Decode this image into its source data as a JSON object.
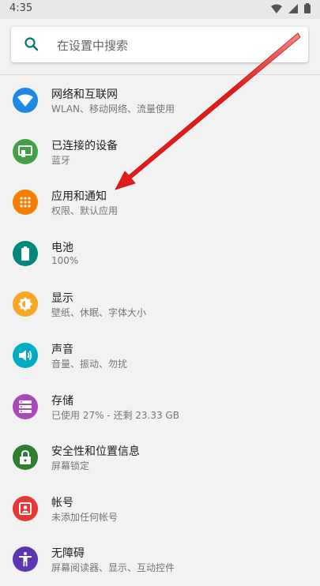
{
  "status_bar": {
    "time": "4:35"
  },
  "search": {
    "placeholder": "在设置中搜索"
  },
  "settings": [
    {
      "title": "网络和互联网",
      "subtitle": "WLAN、移动网络、流量使用",
      "color": "#1e88e5",
      "icon": "wifi-icon"
    },
    {
      "title": "已连接的设备",
      "subtitle": "蓝牙",
      "color": "#43a047",
      "icon": "connected-devices-icon"
    },
    {
      "title": "应用和通知",
      "subtitle": "权限、默认应用",
      "color": "#f57c00",
      "icon": "apps-grid-icon"
    },
    {
      "title": "电池",
      "subtitle": "100%",
      "color": "#00897b",
      "icon": "battery-icon"
    },
    {
      "title": "显示",
      "subtitle": "壁纸、休眠、字体大小",
      "color": "#f9a825",
      "icon": "brightness-icon"
    },
    {
      "title": "声音",
      "subtitle": "音量、振动、勿扰",
      "color": "#00acc1",
      "icon": "volume-icon"
    },
    {
      "title": "存储",
      "subtitle": "已使用 27% - 还剩 23.33 GB",
      "color": "#ab47bc",
      "icon": "storage-icon"
    },
    {
      "title": "安全性和位置信息",
      "subtitle": "屏幕锁定",
      "color": "#2e7d32",
      "icon": "lock-icon"
    },
    {
      "title": "帐号",
      "subtitle": "未添加任何帐号",
      "color": "#e53935",
      "icon": "account-icon"
    },
    {
      "title": "无障碍",
      "subtitle": "屏幕阅读器、显示、互动控件",
      "color": "#5e35b1",
      "icon": "accessibility-icon"
    }
  ],
  "annotation": {
    "color": "#e21b1b"
  }
}
